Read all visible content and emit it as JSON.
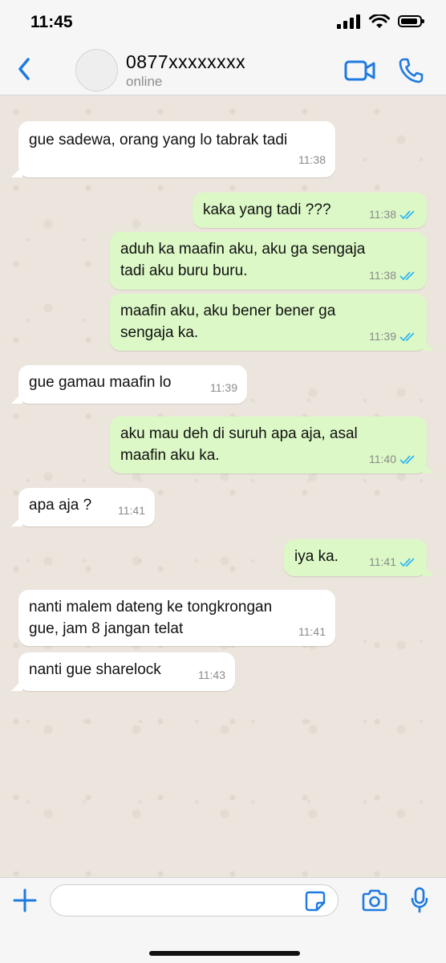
{
  "status_bar": {
    "time": "11:45",
    "icons": [
      "signal-icon",
      "wifi-icon",
      "battery-icon"
    ]
  },
  "header": {
    "contact_name": "0877xxxxxxxx",
    "status": "online",
    "accent_color": "#1f7ae0",
    "icons": [
      "back-chevron-icon",
      "video-call-icon",
      "phone-call-icon"
    ]
  },
  "messages": [
    {
      "direction": "in",
      "text_lines": [
        "gue sadewa, orang yang lo tabrak tadi"
      ],
      "time": "11:38",
      "read": false
    },
    {
      "direction": "out",
      "text_lines": [
        "kaka yang tadi ???"
      ],
      "time": "11:38",
      "read": true
    },
    {
      "direction": "out",
      "text_lines": [
        "aduh ka maafin aku, aku ga sengaja",
        "tadi aku buru buru."
      ],
      "time": "11:38",
      "read": true
    },
    {
      "direction": "out",
      "text_lines": [
        "maafin aku, aku bener bener ga",
        "sengaja ka."
      ],
      "time": "11:39",
      "read": true
    },
    {
      "direction": "in",
      "text_lines": [
        "gue gamau maafin lo"
      ],
      "time": "11:39",
      "read": false
    },
    {
      "direction": "out",
      "text_lines": [
        "aku mau deh di suruh apa aja, asal",
        "maafin aku ka."
      ],
      "time": "11:40",
      "read": true
    },
    {
      "direction": "in",
      "text_lines": [
        "apa aja ?"
      ],
      "time": "11:41",
      "read": false
    },
    {
      "direction": "out",
      "text_lines": [
        "iya ka."
      ],
      "time": "11:41",
      "read": true
    },
    {
      "direction": "in",
      "text_lines": [
        "nanti malem dateng ke tongkrongan",
        "gue, jam 8 jangan telat"
      ],
      "time": "11:41",
      "read": false
    },
    {
      "direction": "in",
      "text_lines": [
        "nanti gue sharelock"
      ],
      "time": "11:43",
      "read": false
    }
  ],
  "colors": {
    "incoming_bubble": "#ffffff",
    "outgoing_bubble": "#dcf8c6",
    "read_ticks": "#34b7f1",
    "chat_background": "#ece5dd"
  },
  "input_bar": {
    "placeholder": "",
    "icons": [
      "plus-icon",
      "sticker-icon",
      "camera-icon",
      "microphone-icon"
    ]
  }
}
